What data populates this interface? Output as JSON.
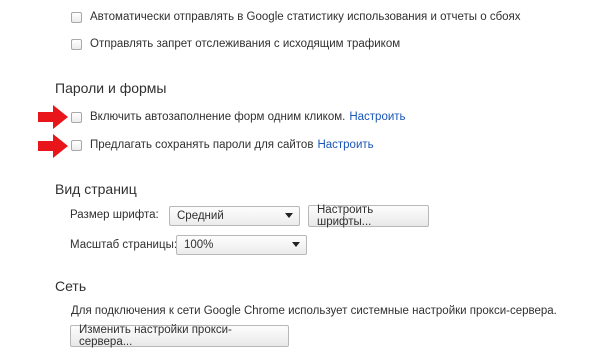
{
  "privacy": {
    "send_stats_label": "Автоматически отправлять в Google статистику использования и отчеты о сбоях",
    "do_not_track_label": "Отправлять запрет отслеживания с исходящим трафиком"
  },
  "passwords_forms": {
    "heading": "Пароли и формы",
    "autofill_label": "Включить автозаполнение форм одним кликом.",
    "autofill_link": "Настроить",
    "save_passwords_label": "Предлагать сохранять пароли для сайтов",
    "save_passwords_link": "Настроить"
  },
  "web_content": {
    "heading": "Вид страниц",
    "font_size_label": "Размер шрифта:",
    "font_size_value": "Средний",
    "customize_fonts_button": "Настроить шрифты...",
    "page_zoom_label": "Масштаб страницы:",
    "page_zoom_value": "100%"
  },
  "network": {
    "heading": "Сеть",
    "description": "Для подключения к сети Google Chrome использует системные настройки прокси-сервера.",
    "proxy_button": "Изменить настройки прокси-сервера..."
  },
  "colors": {
    "arrow": "#e8151b",
    "link": "#1a56b5"
  }
}
